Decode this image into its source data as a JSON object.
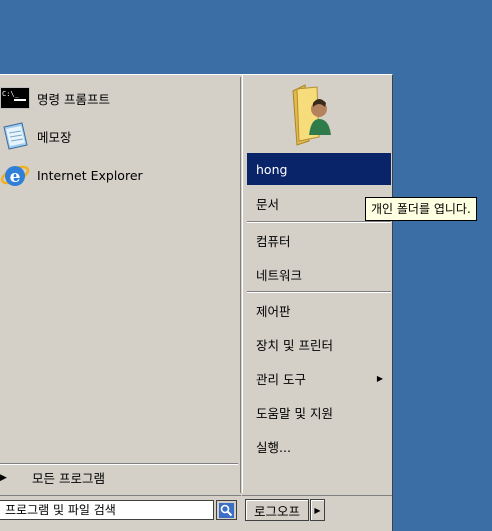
{
  "left_pane": {
    "programs": [
      {
        "label": "명령 프롬프트",
        "icon": "command-prompt-icon"
      },
      {
        "label": "메모장",
        "icon": "notepad-icon"
      },
      {
        "label": "Internet Explorer",
        "icon": "internet-explorer-icon"
      }
    ],
    "all_programs_label": "모든 프로그램",
    "search_placeholder": "프로그램 및 파일 검색"
  },
  "right_pane": {
    "user_name": "hong",
    "items": [
      {
        "label": "문서"
      },
      {
        "label": "컴퓨터"
      },
      {
        "label": "네트워크"
      },
      {
        "label": "제어판"
      },
      {
        "label": "장치 및 프린터"
      },
      {
        "label": "관리 도구",
        "has_submenu": true
      },
      {
        "label": "도움말 및 지원"
      },
      {
        "label": "실행..."
      }
    ]
  },
  "logoff_label": "로그오프",
  "tooltip": "개인 폴더를 엽니다.",
  "colors": {
    "desktop": "#3a6ea5",
    "menu_bg": "#d4d0c8",
    "selection": "#0a246a",
    "tooltip_bg": "#ffffe1"
  }
}
